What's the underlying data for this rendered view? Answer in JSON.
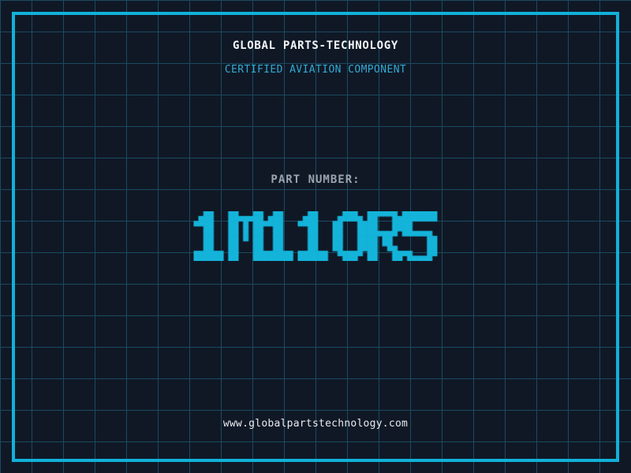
{
  "theme": {
    "background_color": "#101826",
    "grid_line_color": "#1b4a5f",
    "frame_color": "#11b1d9"
  },
  "header": {
    "title": "GLOBAL PARTS-TECHNOLOGY",
    "title_color": "#f3f6f8",
    "subtitle": "CERTIFIED AVIATION COMPONENT",
    "subtitle_color": "#31abd4"
  },
  "part_number": {
    "label": "PART NUMBER:",
    "label_color": "#9aa4b0",
    "value": "1M11OR5",
    "value_color": "#14b4da"
  },
  "footer": {
    "website": "www.globalpartstechnology.com",
    "website_color": "#e8ecef"
  }
}
